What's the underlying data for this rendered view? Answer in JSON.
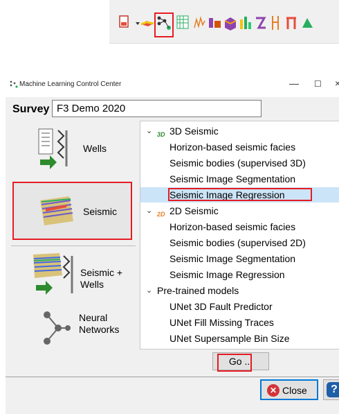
{
  "toolbar": {
    "icons": [
      "plugin-icon",
      "pick-icon",
      "ml-icon",
      "wells-grid-icon",
      "attribute-icon",
      "horizon-icon",
      "volume-icon",
      "bar-icon",
      "flow-icon",
      "split-icon",
      "pillar-icon",
      "extra-icon"
    ],
    "highlighted": "ml-icon"
  },
  "dialog": {
    "title": "Machine Learning Control Center",
    "min_glyph": "—",
    "max_glyph": "☐",
    "close_glyph": "×",
    "survey_label": "Survey",
    "survey_value": "F3 Demo 2020",
    "categories": [
      {
        "label": "Wells"
      },
      {
        "label": "Seismic"
      },
      {
        "label": "Seismic +\nWells"
      },
      {
        "label": "Neural\nNetworks"
      }
    ],
    "tree": [
      {
        "label": "3D Seismic",
        "badge": "3D",
        "level": 0
      },
      {
        "label": "Horizon-based seismic facies",
        "level": 1
      },
      {
        "label": "Seismic bodies (supervised 3D)",
        "level": 1
      },
      {
        "label": "Seismic Image Segmentation",
        "level": 1
      },
      {
        "label": "Seismic Image Regression",
        "level": 1,
        "selected": true
      },
      {
        "label": "2D Seismic",
        "badge": "2D",
        "level": 0
      },
      {
        "label": "Horizon-based seismic facies",
        "level": 1
      },
      {
        "label": "Seismic bodies (supervised 2D)",
        "level": 1
      },
      {
        "label": "Seismic Image Segmentation",
        "level": 1
      },
      {
        "label": "Seismic Image Regression",
        "level": 1
      },
      {
        "label": "Pre-trained models",
        "level": 0
      },
      {
        "label": "UNet 3D Fault Predictor",
        "level": 1
      },
      {
        "label": "UNet Fill Missing Traces",
        "level": 1
      },
      {
        "label": "UNet Supersample Bin Size",
        "level": 1
      }
    ],
    "go_label": "Go ...",
    "close_label": "Close",
    "help_glyph": "?"
  },
  "colors": {
    "highlight": "#e51c23",
    "selection": "#cce4f7",
    "accent": "#0078d7"
  }
}
